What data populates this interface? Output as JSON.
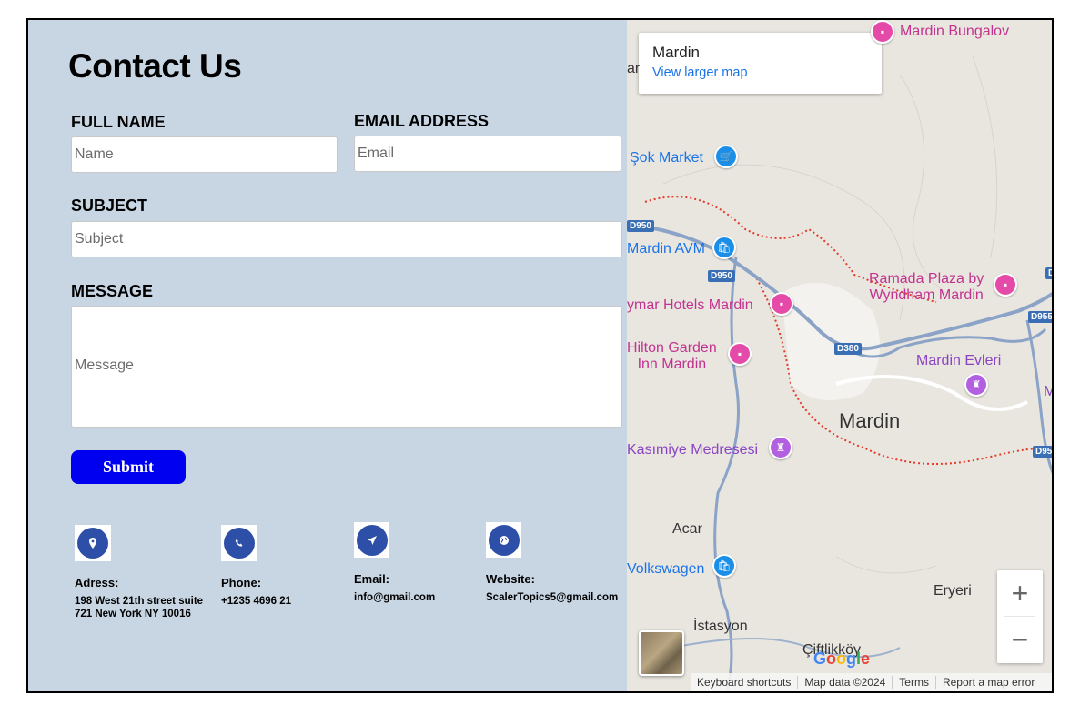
{
  "form": {
    "title": "Contact Us",
    "full_name_label": "FULL NAME",
    "full_name_placeholder": "Name",
    "email_label": "EMAIL ADDRESS",
    "email_placeholder": "Email",
    "subject_label": "SUBJECT",
    "subject_placeholder": "Subject",
    "message_label": "MESSAGE",
    "message_placeholder": "Message",
    "submit_label": "Submit"
  },
  "contact_info": [
    {
      "icon": "location-icon",
      "heading": "Adress:",
      "value": "198 West 21th street suite 721 New York NY 10016"
    },
    {
      "icon": "phone-icon",
      "heading": "Phone:",
      "value": "+1235 4696 21"
    },
    {
      "icon": "send-icon",
      "heading": "Email:",
      "value": "info@gmail.com"
    },
    {
      "icon": "globe-icon",
      "heading": "Website:",
      "value": "ScalerTopics5@gmail.com"
    }
  ],
  "map": {
    "place_name": "Mardin",
    "larger_map_link": "View larger map",
    "labels": {
      "mardin_bungalov": "Mardin Bungalov",
      "sok_market": "Şok Market",
      "mardin_avm": "Mardin AVM",
      "ramada": "Ramada Plaza by Wyndham Mardin",
      "ramada_line1": "Ramada Plaza by",
      "ramada_line2": "Wyndham Mardin",
      "aymar": "ymar Hotels Mardin",
      "hilton_line1": "Hilton Garden",
      "hilton_line2": "Inn Mardin",
      "mardin_evleri": "Mardin Evleri",
      "city": "Mardin",
      "kasimiye": "Kasımiye Medresesi",
      "acar": "Acar",
      "volkswagen": "Volkswagen",
      "eryeri": "Eryeri",
      "istasyon": "İstasyon",
      "ciftlikkoy": "Çiftlikköy",
      "edge_ar": "ar",
      "edge_m": "M"
    },
    "road_labels": [
      "D950",
      "D950",
      "D380",
      "D955",
      "D95",
      "D"
    ],
    "zoom_in": "+",
    "zoom_out": "−",
    "footer": [
      "Keyboard shortcuts",
      "Map data ©2024",
      "Terms",
      "Report a map error"
    ],
    "google": "Google"
  },
  "colors": {
    "panel_bg": "#c8d6e4",
    "submit_bg": "#0000f0",
    "icon_bg": "#2d4fa7",
    "map_bg": "#e9e6e0"
  }
}
